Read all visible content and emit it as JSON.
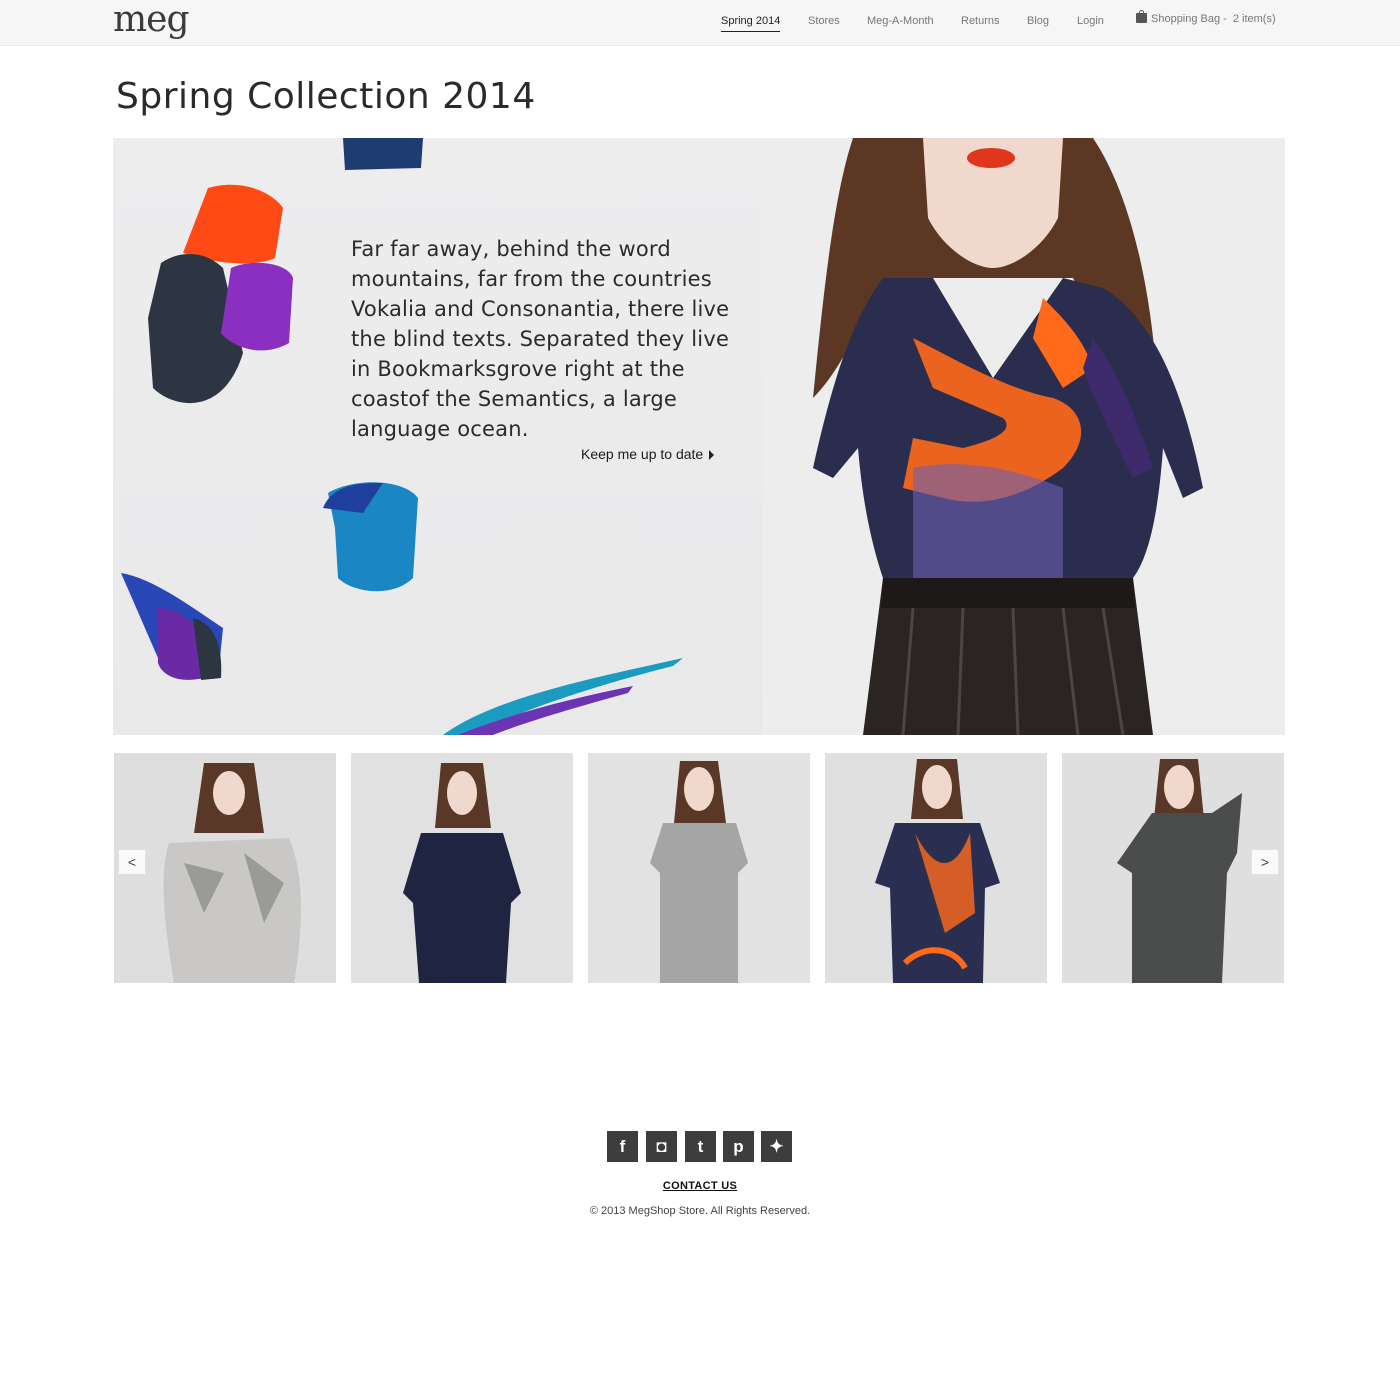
{
  "header": {
    "logo": "meg",
    "nav": [
      {
        "label": "Spring 2014",
        "active": true
      },
      {
        "label": "Stores"
      },
      {
        "label": "Meg-A-Month"
      },
      {
        "label": "Returns"
      },
      {
        "label": "Blog"
      },
      {
        "label": "Login"
      }
    ],
    "bag": {
      "label": "Shopping Bag -",
      "count": "2 item(s)",
      "icon": "shopping-bag-icon"
    }
  },
  "page": {
    "title": "Spring Collection 2014"
  },
  "hero": {
    "text": "Far far away, behind the word mountains, far from the countries Vokalia and Consonantia, there live the blind texts. Separated they live in Bookmarksgrove right at the coastof the Semantics, a large language ocean.",
    "cta": "Keep me up to date"
  },
  "carousel": {
    "prev": "<",
    "next": ">",
    "items": [
      {
        "outfit": "fur top",
        "color": "#bdbdbd"
      },
      {
        "outfit": "navy dress",
        "color": "#1f2540"
      },
      {
        "outfit": "tweed dress",
        "color": "#9a9a9a"
      },
      {
        "outfit": "painted print top",
        "color": "#2a2f52"
      },
      {
        "outfit": "check dress",
        "color": "#4a4d4c"
      }
    ]
  },
  "footer": {
    "social": [
      {
        "glyph": "f",
        "icon": "facebook-icon"
      },
      {
        "glyph": "◘",
        "icon": "instagram-icon"
      },
      {
        "glyph": "t",
        "icon": "tumblr-icon"
      },
      {
        "glyph": "p",
        "icon": "pinterest-icon"
      },
      {
        "glyph": "✦",
        "icon": "twitter-icon"
      }
    ],
    "contact": "CONTACT US",
    "copyright": "© 2013 MegShop Store.  All Rights Reserved."
  }
}
